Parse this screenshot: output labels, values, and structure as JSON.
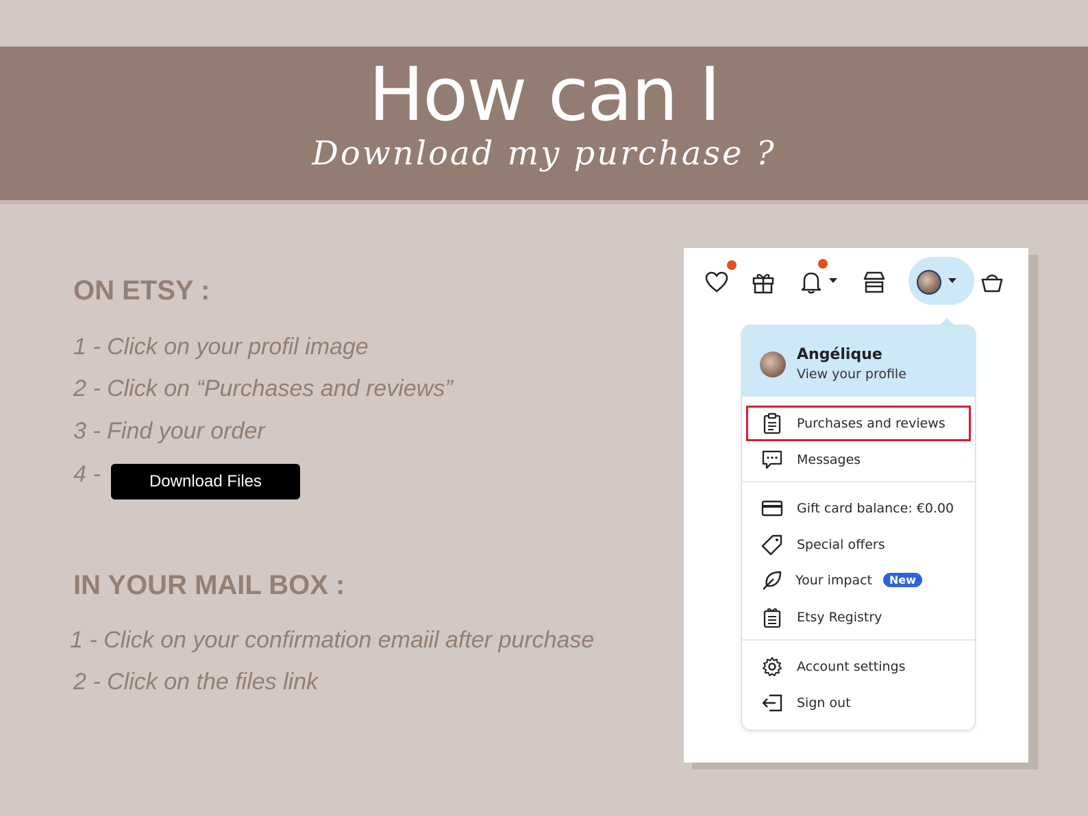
{
  "banner": {
    "title": "How can I",
    "subtitle": "Download my purchase ?"
  },
  "etsy": {
    "heading": "ON ETSY :",
    "steps": [
      "1 - Click on your profil image",
      "2 - Click on “Purchases and reviews”",
      "3 - Find your order",
      "4 -"
    ],
    "download_button": "Download Files"
  },
  "mailbox": {
    "heading": "IN YOUR MAIL BOX :",
    "steps": [
      "1 - Click on your confirmation emaiil after purchase",
      "2 - Click on the files link"
    ]
  },
  "screenshot": {
    "top_icons": [
      "heart-icon",
      "gift-icon",
      "bell-icon",
      "shop-icon",
      "avatar",
      "basket-icon"
    ],
    "profile": {
      "name": "Angélique",
      "link": "View your profile"
    },
    "menu": {
      "purchases": "Purchases and reviews",
      "messages": "Messages",
      "gift_card": "Gift card balance: €0.00",
      "special_offers": "Special offers",
      "impact": "Your impact",
      "impact_badge": "New",
      "registry": "Etsy Registry",
      "account_settings": "Account settings",
      "sign_out": "Sign out"
    },
    "colors": {
      "notification_dot": "#e0501c",
      "highlight": "#d61f2c",
      "badge": "#2f62e0",
      "profile_bg": "#cde8f6"
    }
  }
}
